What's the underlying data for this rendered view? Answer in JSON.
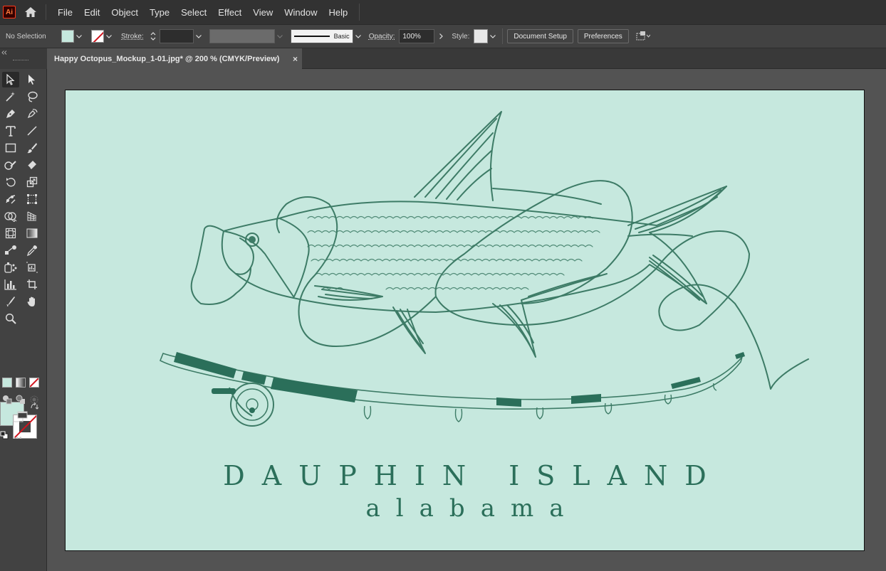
{
  "app": {
    "logo_text": "Ai",
    "accent": "#ff7a3c"
  },
  "menu": [
    "File",
    "Edit",
    "Object",
    "Type",
    "Select",
    "Effect",
    "View",
    "Window",
    "Help"
  ],
  "control": {
    "selection": "No Selection",
    "stroke_label": "Stroke:",
    "stroke_value": "",
    "brush_label": "Basic",
    "opacity_label": "Opacity:",
    "opacity_value": "100%",
    "style_label": "Style:",
    "document_setup": "Document Setup",
    "preferences": "Preferences"
  },
  "document": {
    "tab_title": "Happy Octopus_Mockup_1-01.jpg* @ 200 % (CMYK/Preview)",
    "close_glyph": "×"
  },
  "artwork": {
    "title": "DAUPHIN ISLAND",
    "subtitle": "alabama",
    "fill_color": "#c6e8de",
    "ink_color": "#2b6f5a"
  },
  "toolbar": {
    "more_glyph": "•••",
    "tools": [
      "selection-tool",
      "direct-selection-tool",
      "magic-wand-tool",
      "lasso-tool",
      "pen-tool",
      "curvature-tool",
      "type-tool",
      "line-segment-tool",
      "rectangle-tool",
      "paintbrush-tool",
      "shaper-tool",
      "eraser-tool",
      "rotate-tool",
      "scale-tool",
      "puppet-warp-tool",
      "free-transform-tool",
      "shape-builder-tool",
      "perspective-grid-tool",
      "mesh-tool",
      "gradient-tool",
      "blend-tool",
      "eyedropper-tool",
      "symbol-sprayer-tool",
      "artboard-tool",
      "graph-tool",
      "slice-tool",
      "width-tool",
      "hand-tool",
      "zoom-tool"
    ]
  }
}
